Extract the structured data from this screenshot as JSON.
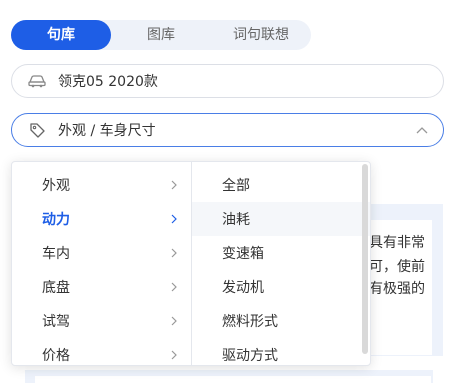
{
  "tabs": [
    {
      "label": "句库",
      "active": true
    },
    {
      "label": "图库",
      "active": false
    },
    {
      "label": "词句联想",
      "active": false
    }
  ],
  "car_selector": {
    "icon": "car-icon",
    "value": "领克05 2020款"
  },
  "category_selector": {
    "icon": "tag-icon",
    "value": "外观 / 车身尺寸"
  },
  "background_text": {
    "line1": "具有非常",
    "line2": "可，使前",
    "line3": "有极强的"
  },
  "cascader": {
    "level1": [
      {
        "label": "外观",
        "active": false
      },
      {
        "label": "动力",
        "active": true
      },
      {
        "label": "车内",
        "active": false
      },
      {
        "label": "底盘",
        "active": false
      },
      {
        "label": "试驾",
        "active": false
      },
      {
        "label": "价格",
        "active": false
      }
    ],
    "level2": [
      {
        "label": "全部"
      },
      {
        "label": "油耗"
      },
      {
        "label": "变速箱"
      },
      {
        "label": "发动机"
      },
      {
        "label": "燃料形式"
      },
      {
        "label": "驱动方式"
      }
    ]
  },
  "colors": {
    "accent": "#1e5ee6",
    "tab_bg": "#eef2f9",
    "card_bg": "#edf2fb"
  }
}
